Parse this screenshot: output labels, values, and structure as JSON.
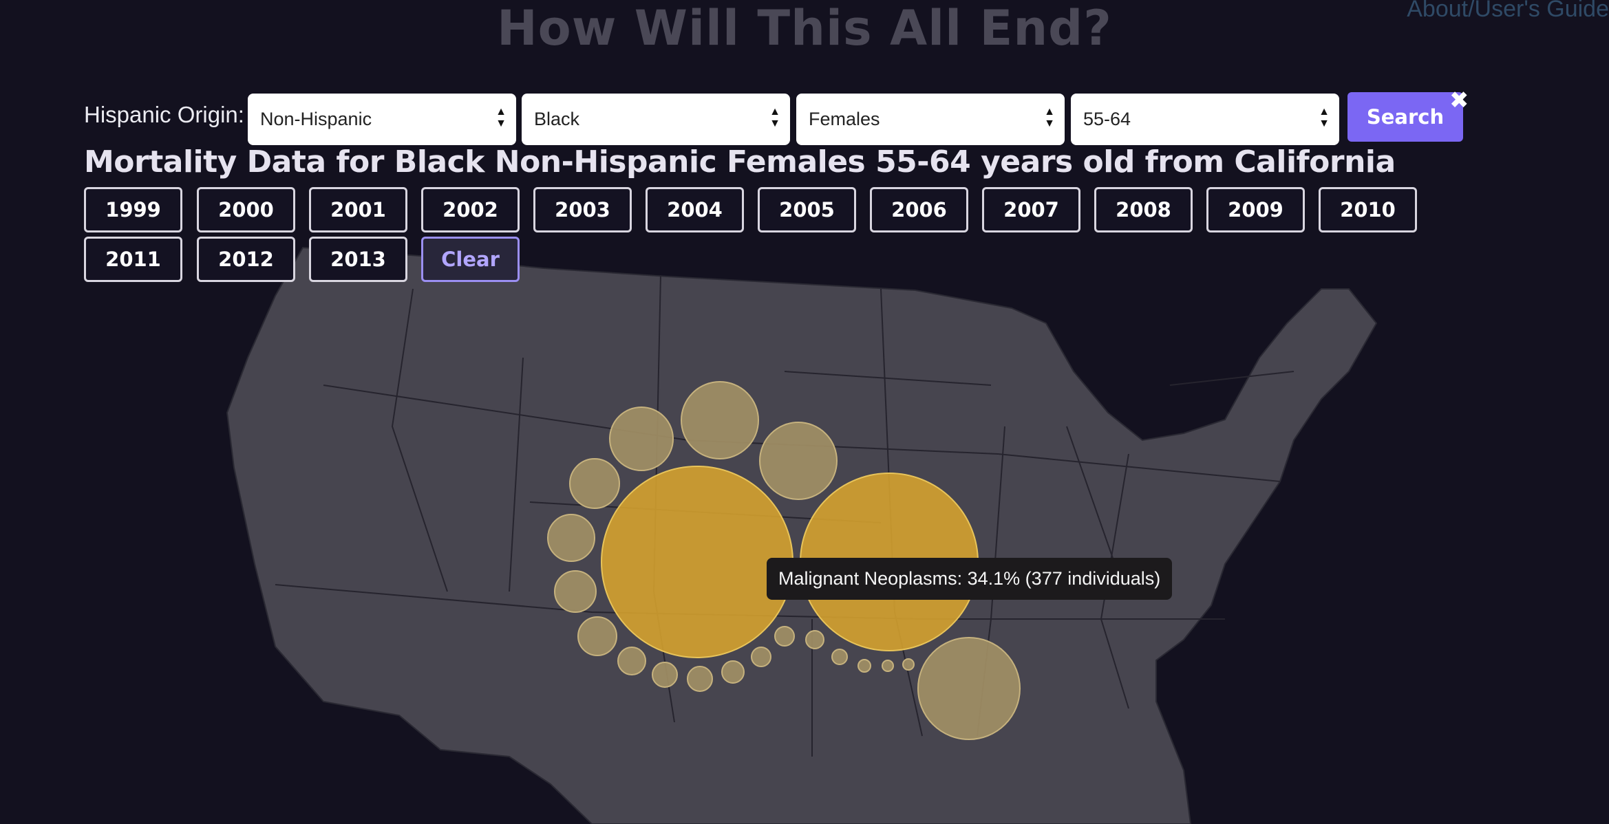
{
  "header": {
    "title": "How Will This All End?",
    "about_link": "About/User's Guide"
  },
  "filters": {
    "origin_label": "Hispanic Origin:",
    "origin": "Non-Hispanic",
    "race": "Black",
    "sex": "Females",
    "age": "55-64",
    "search_label": "Search",
    "close_symbol": "✖"
  },
  "subtitle": "Mortality Data for Black Non-Hispanic Females 55-64 years old from California",
  "years": [
    "1999",
    "2000",
    "2001",
    "2002",
    "2003",
    "2004",
    "2005",
    "2006",
    "2007",
    "2008",
    "2009",
    "2010",
    "2011",
    "2012",
    "2013"
  ],
  "clear_label": "Clear",
  "tooltip": "Malignant Neoplasms: 34.1% (377 individuals)",
  "colors": {
    "background": "#13111f",
    "map_fill": "#47454f",
    "bubble_large": "#d4a12f",
    "bubble_small": "#a18f65",
    "button_accent": "#7b67f3"
  }
}
